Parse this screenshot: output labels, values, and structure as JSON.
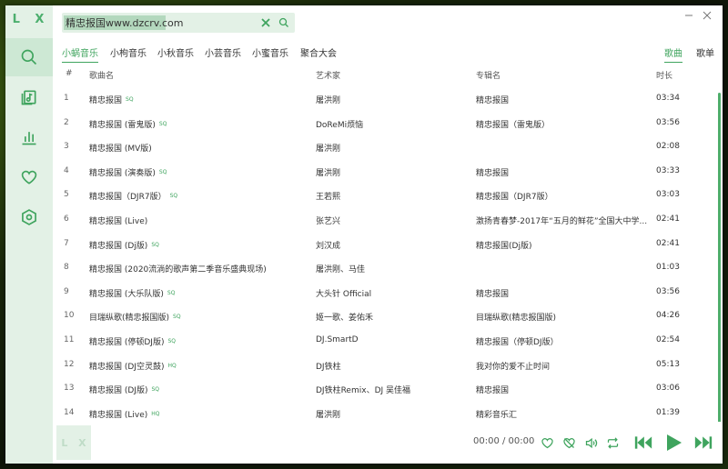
{
  "app": {
    "logo": "L X",
    "cover_logo": "L X"
  },
  "search": {
    "value": "精忠报国www.dzcrv.com"
  },
  "source_tabs": [
    {
      "label": "小蜗音乐",
      "active": true
    },
    {
      "label": "小枸音乐",
      "active": false
    },
    {
      "label": "小秋音乐",
      "active": false
    },
    {
      "label": "小芸音乐",
      "active": false
    },
    {
      "label": "小蜜音乐",
      "active": false
    },
    {
      "label": "聚合大会",
      "active": false
    }
  ],
  "type_tabs": [
    {
      "label": "歌曲",
      "active": true
    },
    {
      "label": "歌单",
      "active": false
    }
  ],
  "table": {
    "headers": {
      "num": "#",
      "name": "歌曲名",
      "artist": "艺术家",
      "album": "专辑名",
      "time": "时长"
    },
    "rows": [
      {
        "num": "1",
        "name": "精忠报国",
        "quality": "SQ",
        "artist": "屠洪刚",
        "album": "精忠报国",
        "time": "03:34"
      },
      {
        "num": "2",
        "name": "精忠报国 (雷鬼版)",
        "quality": "SQ",
        "artist": "DoReMi烦恼",
        "album": "精忠报国（雷鬼版）",
        "time": "03:56"
      },
      {
        "num": "3",
        "name": "精忠报国 (MV版)",
        "quality": "",
        "artist": "屠洪刚",
        "album": "",
        "time": "02:08"
      },
      {
        "num": "4",
        "name": "精忠报国 (演奏版)",
        "quality": "SQ",
        "artist": "屠洪刚",
        "album": "精忠报国",
        "time": "03:33"
      },
      {
        "num": "5",
        "name": "精忠报国（DJR7版）",
        "quality": "SQ",
        "artist": "王若熙",
        "album": "精忠报国（DJR7版）",
        "time": "03:03"
      },
      {
        "num": "6",
        "name": "精忠报国 (Live)",
        "quality": "",
        "artist": "张艺兴",
        "album": "激扬青春梦-2017年“五月的鲜花”全国大中学...",
        "time": "02:41"
      },
      {
        "num": "7",
        "name": "精忠报国 (Dj版)",
        "quality": "SQ",
        "artist": "刘汉成",
        "album": "精忠报国(Dj版)",
        "time": "02:41"
      },
      {
        "num": "8",
        "name": "精忠报国 (2020流淌的歌声第二季音乐盛典现场)",
        "quality": "",
        "artist": "屠洪刚、马佳",
        "album": "",
        "time": "01:03"
      },
      {
        "num": "9",
        "name": "精忠报国 (大乐队版)",
        "quality": "SQ",
        "artist": "大头针 Official",
        "album": "精忠报国",
        "time": "03:56"
      },
      {
        "num": "10",
        "name": "目瑞纵歌(精忠报国版)",
        "quality": "SQ",
        "artist": "姬一歌、姜佑禾",
        "album": "目瑞纵歌(精忠报国版)",
        "time": "04:26"
      },
      {
        "num": "11",
        "name": "精忠报国 (停顿DJ版)",
        "quality": "SQ",
        "artist": "DJ.SmartD",
        "album": "精忠报国（停顿DJ版）",
        "time": "02:54"
      },
      {
        "num": "12",
        "name": "精忠报国 (DJ空灵鼓)",
        "quality": "HQ",
        "artist": "DJ铁柱",
        "album": "我对你的爱不止时间",
        "time": "05:13"
      },
      {
        "num": "13",
        "name": "精忠报国 (DJ版)",
        "quality": "SQ",
        "artist": "DJ铁柱Remix、DJ 吴佳福",
        "album": "精忠报国",
        "time": "03:06"
      },
      {
        "num": "14",
        "name": "精忠报国 (Live)",
        "quality": "HQ",
        "artist": "屠洪刚",
        "album": "精彩音乐汇",
        "time": "01:39"
      }
    ]
  },
  "player": {
    "time": "00:00 / 00:00"
  },
  "colors": {
    "accent": "#3fa45e",
    "sidebar_bg": "#e3f1e6"
  }
}
